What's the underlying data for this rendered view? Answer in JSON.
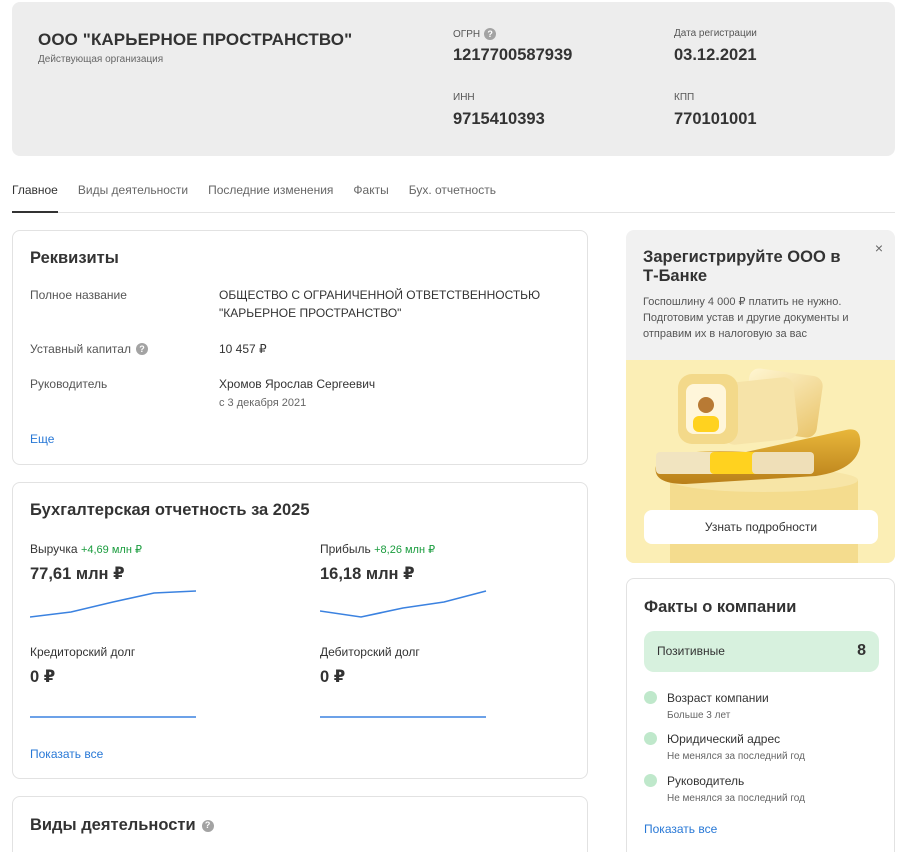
{
  "company": {
    "name": "ООО \"КАРЬЕРНОЕ ПРОСТРАНСТВО\"",
    "status": "Действующая организация",
    "ogrn_label": "ОГРН",
    "ogrn": "1217700587939",
    "reg_date_label": "Дата регистрации",
    "reg_date": "03.12.2021",
    "inn_label": "ИНН",
    "inn": "9715410393",
    "kpp_label": "КПП",
    "kpp": "770101001"
  },
  "tabs": [
    {
      "label": "Главное",
      "active": true
    },
    {
      "label": "Виды деятельности",
      "active": false
    },
    {
      "label": "Последние изменения",
      "active": false
    },
    {
      "label": "Факты",
      "active": false
    },
    {
      "label": "Бух. отчетность",
      "active": false
    }
  ],
  "requisites": {
    "title": "Реквизиты",
    "full_name_label": "Полное название",
    "full_name_line1": "ОБЩЕСТВО С ОГРАНИЧЕННОЙ ОТВЕТСТВЕННОСТЬЮ",
    "full_name_line2": "\"КАРЬЕРНОЕ ПРОСТРАНСТВО\"",
    "capital_label": "Уставный капитал",
    "capital": "10 457 ₽",
    "head_label": "Руководитель",
    "head": "Хромов Ярослав Сергеевич",
    "head_since": "с 3 декабря 2021",
    "more": "Еще"
  },
  "finance": {
    "title": "Бухгалтерская отчетность за 2025",
    "revenue_label": "Выручка",
    "revenue_delta": "+4,69 млн ₽",
    "revenue": "77,61 млн ₽",
    "profit_label": "Прибыль",
    "profit_delta": "+8,26 млн ₽",
    "profit": "16,18 млн ₽",
    "creditor_label": "Кредиторский долг",
    "creditor": "0 ₽",
    "debtor_label": "Дебиторский долг",
    "debtor": "0 ₽",
    "show_all": "Показать все"
  },
  "activities": {
    "title": "Виды деятельности"
  },
  "promo": {
    "title": "Зарегистрируйте ООО в Т-Банке",
    "text": "Госпошлину 4 000 ₽ платить не нужно. Подготовим устав и другие документы и отправим их в налоговую за вас",
    "button": "Узнать подробности",
    "close": "×"
  },
  "facts": {
    "title": "Факты о компании",
    "positive_label": "Позитивные",
    "positive_count": "8",
    "items": [
      {
        "title": "Возраст компании",
        "sub": "Больше 3 лет"
      },
      {
        "title": "Юридический адрес",
        "sub": "Не менялся за последний год"
      },
      {
        "title": "Руководитель",
        "sub": "Не менялся за последний год"
      }
    ],
    "show_all": "Показать все"
  },
  "colors": {
    "accent_link": "#2878d6",
    "positive_green": "#1a9c3e",
    "sparkline": "#3b82e0",
    "header_bg": "#ededed",
    "facts_badge_bg": "#d7f1de"
  }
}
